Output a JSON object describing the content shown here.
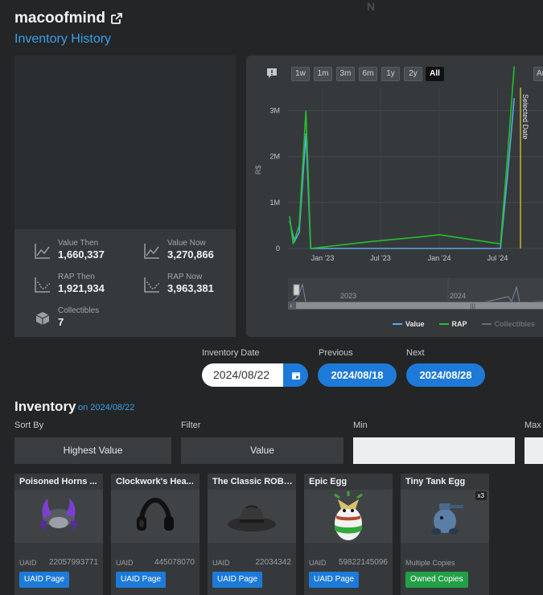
{
  "header": {
    "username": "macoofmind",
    "subtitle": "Inventory History"
  },
  "stats": {
    "value_then_label": "Value Then",
    "value_then": "1,660,337",
    "value_now_label": "Value Now",
    "value_now": "3,270,866",
    "rap_then_label": "RAP Then",
    "rap_then": "1,921,934",
    "rap_now_label": "RAP Now",
    "rap_now": "3,963,381",
    "collectibles_label": "Collectibles",
    "collectibles": "7"
  },
  "chart": {
    "ranges": [
      "1w",
      "1m",
      "3m",
      "6m",
      "1y",
      "2y",
      "All"
    ],
    "active_range": "All",
    "au_label": "Au",
    "selected_label": "Selected Date",
    "legend": {
      "value": "Value",
      "rap": "RAP",
      "collectibles": "Collectibles"
    },
    "colors": {
      "value": "#5aa9e6",
      "rap": "#22c02a",
      "collectibles": "#6b6e71",
      "selected": "#e4d82b"
    },
    "nav_labels": [
      "2023",
      "2024"
    ]
  },
  "chart_data": {
    "type": "line",
    "ylabel": "R$",
    "y_ticks": [
      "0",
      "1M",
      "2M",
      "3M"
    ],
    "x_ticks": [
      "Jan '23",
      "Jul '23",
      "Jan '24",
      "Jul '24"
    ],
    "series": [
      {
        "name": "Value",
        "points": [
          {
            "x": "2022-09-20",
            "y": 600000
          },
          {
            "x": "2022-10-05",
            "y": 150000
          },
          {
            "x": "2022-10-20",
            "y": 350000
          },
          {
            "x": "2022-11-10",
            "y": 2500000
          },
          {
            "x": "2022-11-25",
            "y": 0
          },
          {
            "x": "2024-07-10",
            "y": 0
          },
          {
            "x": "2024-08-01",
            "y": 1600000
          },
          {
            "x": "2024-08-22",
            "y": 3270866
          }
        ]
      },
      {
        "name": "RAP",
        "points": [
          {
            "x": "2022-09-20",
            "y": 700000
          },
          {
            "x": "2022-10-01",
            "y": 100000
          },
          {
            "x": "2022-10-20",
            "y": 500000
          },
          {
            "x": "2022-11-10",
            "y": 3000000
          },
          {
            "x": "2022-11-25",
            "y": 0
          },
          {
            "x": "2023-06-01",
            "y": 150000
          },
          {
            "x": "2023-11-01",
            "y": 250000
          },
          {
            "x": "2024-01-01",
            "y": 300000
          },
          {
            "x": "2024-07-10",
            "y": 100000
          },
          {
            "x": "2024-08-01",
            "y": 2000000
          },
          {
            "x": "2024-08-22",
            "y": 3963381
          }
        ]
      }
    ],
    "ylim": [
      0,
      3500000
    ]
  },
  "controls": {
    "inventory_date_label": "Inventory Date",
    "inventory_date": "2024/08/22",
    "previous_label": "Previous",
    "previous_date": "2024/08/18",
    "next_label": "Next",
    "next_date": "2024/08/28"
  },
  "inventory": {
    "title": "Inventory",
    "on_date": "on 2024/08/22",
    "sort_label": "Sort By",
    "sort_value": "Highest Value",
    "filter_label": "Filter",
    "filter_value": "Value",
    "min_label": "Min",
    "max_label": "Max",
    "items": [
      {
        "name": "Poisoned Horns ...",
        "uaid_label": "UAID",
        "uaid": "22057993771",
        "button": "UAID Page"
      },
      {
        "name": "Clockwork's Hea...",
        "uaid_label": "UAID",
        "uaid": "445078070",
        "button": "UAID Page"
      },
      {
        "name": "The Classic ROBL...",
        "uaid_label": "UAID",
        "uaid": "22034342",
        "button": "UAID Page"
      },
      {
        "name": "Epic Egg",
        "uaid_label": "UAID",
        "uaid": "59822145096",
        "button": "UAID Page"
      },
      {
        "name": "Tiny Tank Egg",
        "uaid_label": "Multiple Copies",
        "uaid": "",
        "button": "Owned Copies",
        "badge": "x3"
      }
    ]
  }
}
